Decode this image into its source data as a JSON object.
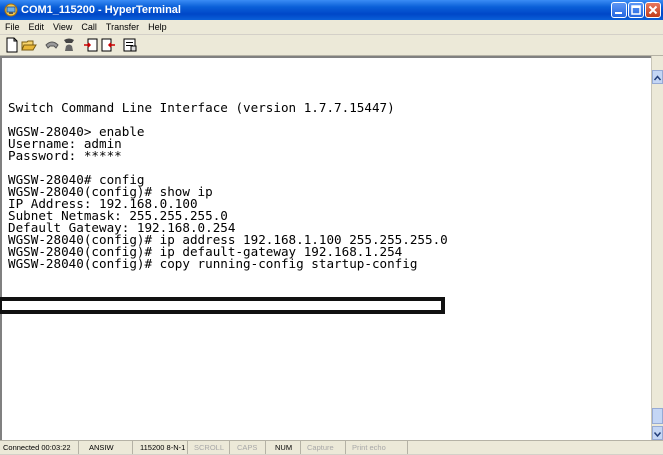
{
  "window": {
    "title": "COM1_115200 - HyperTerminal"
  },
  "menu": [
    "File",
    "Edit",
    "View",
    "Call",
    "Transfer",
    "Help"
  ],
  "toolbar_icons": [
    "new-icon",
    "open-icon",
    "disconnect-phone-icon",
    "dial-icon",
    "send-icon",
    "receive-icon",
    "properties-icon"
  ],
  "terminal_lines": [
    "Switch Command Line Interface (version 1.7.7.15447)",
    "",
    "WGSW-28040> enable",
    "Username: admin",
    "Password: *****",
    "",
    "WGSW-28040# config",
    "WGSW-28040(config)# show ip",
    "IP Address: 192.168.0.100",
    "Subnet Netmask: 255.255.255.0",
    "Default Gateway: 192.168.0.254",
    "WGSW-28040(config)# ip address 192.168.1.100 255.255.255.0",
    "WGSW-28040(config)# ip default-gateway 192.168.1.254",
    "WGSW-28040(config)# copy running-config startup-config"
  ],
  "status": {
    "connected": "Connected 00:03:22",
    "emulation": "ANSIW",
    "settings": "115200 8-N-1",
    "scroll": "SCROLL",
    "caps": "CAPS",
    "num": "NUM",
    "capture": "Capture",
    "print_echo": "Print echo"
  }
}
